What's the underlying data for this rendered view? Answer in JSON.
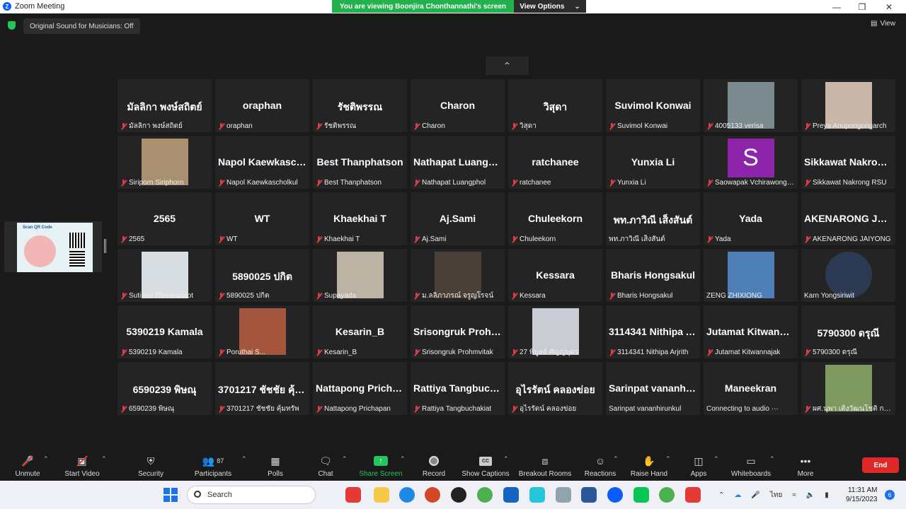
{
  "window": {
    "title": "Zoom Meeting",
    "logo": "Z"
  },
  "banner": {
    "message": "You are viewing Boonjira Chonthannathi's screen",
    "options_label": "View Options"
  },
  "top": {
    "sound_label": "Original Sound for Musicians: Off",
    "view_label": "View"
  },
  "tiles": [
    {
      "name": "มัลลิกา  พงษ์สถิตย์",
      "label": "มัลลิกา  พงษ์สถิตย์",
      "muted": true
    },
    {
      "name": "oraphan",
      "label": "oraphan",
      "muted": true
    },
    {
      "name": "รัชติพรรณ",
      "label": "รัชติพรรณ",
      "muted": true
    },
    {
      "name": "Charon",
      "label": "Charon",
      "muted": true
    },
    {
      "name": "วิสุดา",
      "label": "วิสุดา",
      "muted": true
    },
    {
      "name": "Suvimol Konwai",
      "label": "Suvimol Konwai",
      "muted": true
    },
    {
      "name": "",
      "label": "4005133 verisa",
      "muted": true,
      "photo": "#7a8a8e"
    },
    {
      "name": "",
      "label": "Preya Anupongongarch",
      "muted": true,
      "photo": "#c9b8aa"
    },
    {
      "name": "",
      "label": "Siriporn Siriphorn",
      "muted": true,
      "photo": "#a89070"
    },
    {
      "name": "Napol Kaewkascholkul",
      "label": "Napol Kaewkascholkul",
      "muted": true
    },
    {
      "name": "Best Thanphatson",
      "label": "Best Thanphatson",
      "muted": true
    },
    {
      "name": "Nathapat Luangphol",
      "label": "Nathapat Luangphol",
      "muted": true
    },
    {
      "name": "ratchanee",
      "label": "ratchanee",
      "muted": true
    },
    {
      "name": "Yunxia Li",
      "label": "Yunxia Li",
      "muted": true
    },
    {
      "name": "",
      "label": "Saowapak Vchirawongkwin",
      "muted": true,
      "avatar": "S",
      "avatar_color": "#8e24aa"
    },
    {
      "name": "Sikkawat Nakrong RSU",
      "label": "Sikkawat Nakrong RSU",
      "muted": true
    },
    {
      "name": "2565",
      "label": "2565",
      "muted": true
    },
    {
      "name": "WT",
      "label": "WT",
      "muted": true
    },
    {
      "name": "Khaekhai T",
      "label": "Khaekhai T",
      "muted": true
    },
    {
      "name": "Aj.Sami",
      "label": "Aj.Sami",
      "muted": true
    },
    {
      "name": "Chuleekorn",
      "label": "Chuleekorn",
      "muted": true
    },
    {
      "name": "พท.ภาวิณี  เส็งสันต์",
      "label": "พท.ภาวิณี  เส็งสันต์",
      "muted": false
    },
    {
      "name": "Yada",
      "label": "Yada",
      "muted": true
    },
    {
      "name": "AKENARONG  JAIYONG",
      "label": "AKENARONG JAIYONG",
      "muted": true
    },
    {
      "name": "",
      "label": "Sutinee Threeranoot",
      "muted": true,
      "photo": "#d8dde2"
    },
    {
      "name": "5890025 ปกิต",
      "label": "5890025 ปกิต",
      "muted": true
    },
    {
      "name": "",
      "label": "Supayada",
      "muted": true,
      "photo": "#bdb3a4"
    },
    {
      "name": "",
      "label": "ม.ลลิภาภรณ์ จรูญโรจน์",
      "muted": true,
      "photo": "#4a4038"
    },
    {
      "name": "Kessara",
      "label": "Kessara",
      "muted": true
    },
    {
      "name": "Bharis Hongsakul",
      "label": "Bharis Hongsakul",
      "muted": true
    },
    {
      "name": "",
      "label": "ZENG ZHIXIONG",
      "muted": false,
      "photo": "#4d7fb6"
    },
    {
      "name": "",
      "label": "Karn Yongsiriwit",
      "muted": false,
      "photo": "#2b3a52",
      "round": true
    },
    {
      "name": "5390219 Kamala",
      "label": "5390219 Kamala",
      "muted": true
    },
    {
      "name": "",
      "label": "Poruthai S...",
      "muted": true,
      "photo": "#a4553e"
    },
    {
      "name": "Kesarin_B",
      "label": "Kesarin_B",
      "muted": true
    },
    {
      "name": "Srisongruk Prohmvitak",
      "label": "Srisongruk Prohmvitak",
      "muted": true
    },
    {
      "name": "",
      "label": "27 พิบูลย์ ศัญญบุตร",
      "muted": true,
      "photo": "#c9ccd2"
    },
    {
      "name": "3114341 Nithipa Arjrith",
      "label": "3114341 Nithipa Arjrith",
      "muted": true
    },
    {
      "name": "Jutamat  Kitwannajak",
      "label": "Jutamat Kitwannajak",
      "muted": true
    },
    {
      "name": "5790300 ดรุณี",
      "label": "5790300 ดรุณี",
      "muted": true
    },
    {
      "name": "6590239 พิษณุ",
      "label": "6590239 พิษณุ",
      "muted": true
    },
    {
      "name": "3701217 ชัชชัย คุ้มทรัพย์",
      "label": "3701217 ชัชชัย คุ้มทรัพ",
      "muted": true
    },
    {
      "name": "Nattapong  Prichapan",
      "label": "Nattapong Prichapan",
      "muted": true
    },
    {
      "name": "Rattiya  Tangbuchakiat",
      "label": "Rattiya Tangbuchakiat",
      "muted": true
    },
    {
      "name": "อุไรรัตน์  คลองข่อย",
      "label": "อุไรรัตน์  คลองข่อย",
      "muted": true
    },
    {
      "name": "Sarinpat  vananhirunkul",
      "label": "Sarinpat vananhirunkul",
      "muted": false
    },
    {
      "name": "Maneekran",
      "label": "Connecting to audio ···",
      "muted": false
    },
    {
      "name": "",
      "label": "ผศ.นุพา  เติ้งวัฒนโชติ กพอ",
      "muted": true,
      "photo": "#7e9a60"
    }
  ],
  "share_thumbnail": {
    "title": "Scan QR Code"
  },
  "toolbar": {
    "unmute": "Unmute",
    "start_video": "Start Video",
    "security": "Security",
    "participants": "Participants",
    "participants_count": "87",
    "polls": "Polls",
    "chat": "Chat",
    "share_screen": "Share Screen",
    "record": "Record",
    "captions": "Show Captions",
    "breakout": "Breakout Rooms",
    "reactions": "Reactions",
    "raise_hand": "Raise Hand",
    "apps": "Apps",
    "whiteboards": "Whiteboards",
    "more": "More",
    "end": "End"
  },
  "taskbar": {
    "search_placeholder": "Search",
    "lang": "ไทย",
    "time": "11:31 AM",
    "date": "9/15/2023",
    "notifications": "6"
  },
  "colors": {
    "share_green": "#22c55e",
    "end_red": "#e02828",
    "muted_red": "#e03c3c",
    "tile_bg": "#242424"
  }
}
